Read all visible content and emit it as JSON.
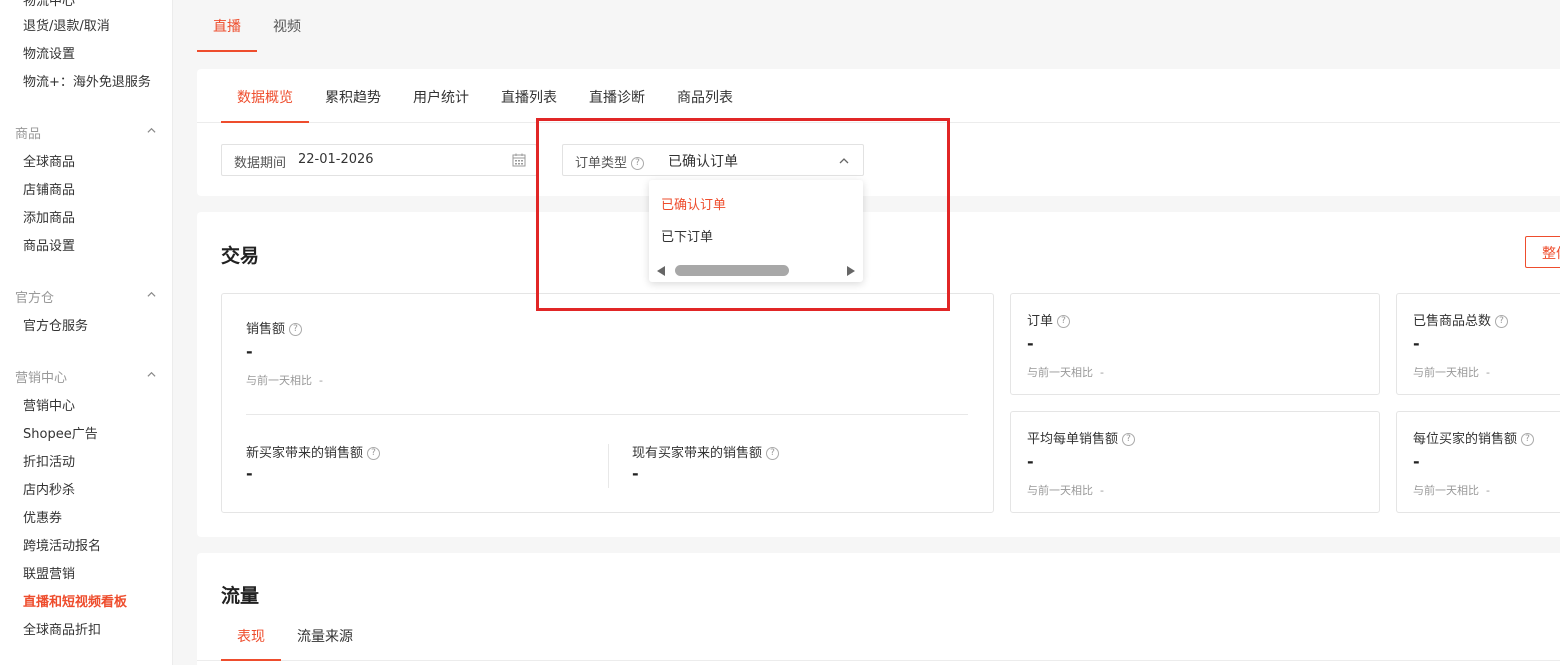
{
  "sidebar": {
    "cut_top_label": "物流中心",
    "groups": [
      {
        "label": "商品",
        "items": [
          "全球商品",
          "店铺商品",
          "添加商品",
          "商品设置"
        ]
      },
      {
        "label": "官方仓",
        "items": [
          "官方仓服务"
        ]
      },
      {
        "label": "营销中心",
        "items": [
          "营销中心",
          "Shopee广告",
          "折扣活动",
          "店内秒杀",
          "优惠券",
          "跨境活动报名",
          "联盟营销",
          "直播和短视频看板",
          "全球商品折扣"
        ]
      }
    ],
    "top_items": [
      "退货/退款/取消",
      "物流设置",
      "物流+：海外免退服务"
    ],
    "active_item": "直播和短视频看板"
  },
  "top_tabs": [
    {
      "label": "直播",
      "active": true
    },
    {
      "label": "视频",
      "active": false
    }
  ],
  "sub_tabs": [
    {
      "label": "数据概览",
      "active": true
    },
    {
      "label": "累积趋势",
      "active": false
    },
    {
      "label": "用户统计",
      "active": false
    },
    {
      "label": "直播列表",
      "active": false
    },
    {
      "label": "直播诊断",
      "active": false
    },
    {
      "label": "商品列表",
      "active": false
    }
  ],
  "filters": {
    "date_label": "数据期间",
    "date_value": "22-01-2026",
    "order_type_label": "订单类型",
    "order_type_value": "已确认订单",
    "dropdown_options": [
      {
        "label": "已确认订单",
        "selected": true
      },
      {
        "label": "已下订单",
        "selected": false
      }
    ]
  },
  "trade": {
    "title": "交易",
    "export_label": "整体",
    "sales": {
      "label": "销售额",
      "value": "-",
      "compare_label": "与前一天相比",
      "compare_value": "-"
    },
    "new_buyer_sales": {
      "label": "新买家带来的销售额",
      "value": "-"
    },
    "existing_buyer_sales": {
      "label": "现有买家带来的销售额",
      "value": "-"
    },
    "orders": {
      "label": "订单",
      "value": "-",
      "compare_label": "与前一天相比",
      "compare_value": "-"
    },
    "items_sold": {
      "label": "已售商品总数",
      "value": "-",
      "compare_label": "与前一天相比",
      "compare_value": "-"
    },
    "avg_order_sales": {
      "label": "平均每单销售额",
      "value": "-",
      "compare_label": "与前一天相比",
      "compare_value": "-"
    },
    "sales_per_buyer": {
      "label": "每位买家的销售额",
      "value": "-",
      "compare_label": "与前一天相比",
      "compare_value": "-"
    }
  },
  "traffic": {
    "title": "流量",
    "tabs": [
      {
        "label": "表现",
        "active": true
      },
      {
        "label": "流量来源",
        "active": false
      }
    ]
  },
  "colors": {
    "accent": "#ee4d2d",
    "highlight": "#e12626"
  }
}
